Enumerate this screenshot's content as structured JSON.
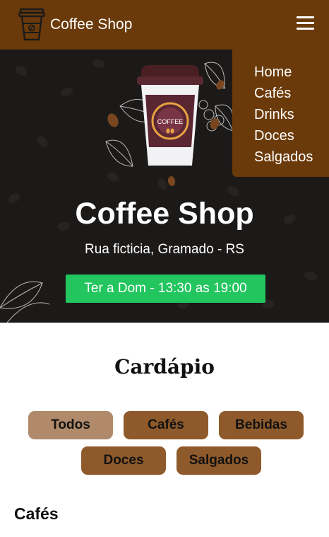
{
  "brand": {
    "name": "Coffee Shop",
    "logo_icon": "coffee-cup-icon"
  },
  "nav": {
    "menu_icon": "hamburger-menu-icon",
    "items": [
      {
        "label": "Home"
      },
      {
        "label": "Cafés"
      },
      {
        "label": "Drinks"
      },
      {
        "label": "Doces"
      },
      {
        "label": "Salgados"
      }
    ]
  },
  "hero": {
    "cup_label": "COFFEE",
    "title": "Coffee Shop",
    "address": "Rua ficticia, Gramado - RS",
    "hours": "Ter a Dom - 13:30 as 19:00"
  },
  "menu": {
    "title": "Cardápio",
    "filters": [
      {
        "label": "Todos",
        "active": true
      },
      {
        "label": "Cafés",
        "active": false
      },
      {
        "label": "Bebidas",
        "active": false
      },
      {
        "label": "Doces",
        "active": false
      },
      {
        "label": "Salgados",
        "active": false
      }
    ],
    "section_title": "Cafés"
  },
  "colors": {
    "navbar": "#6b3a0a",
    "hero_bg": "#1c1a19",
    "hours_badge": "#22c55e",
    "filter_active": "#b08a6a",
    "filter_default": "#8f5a2b"
  }
}
